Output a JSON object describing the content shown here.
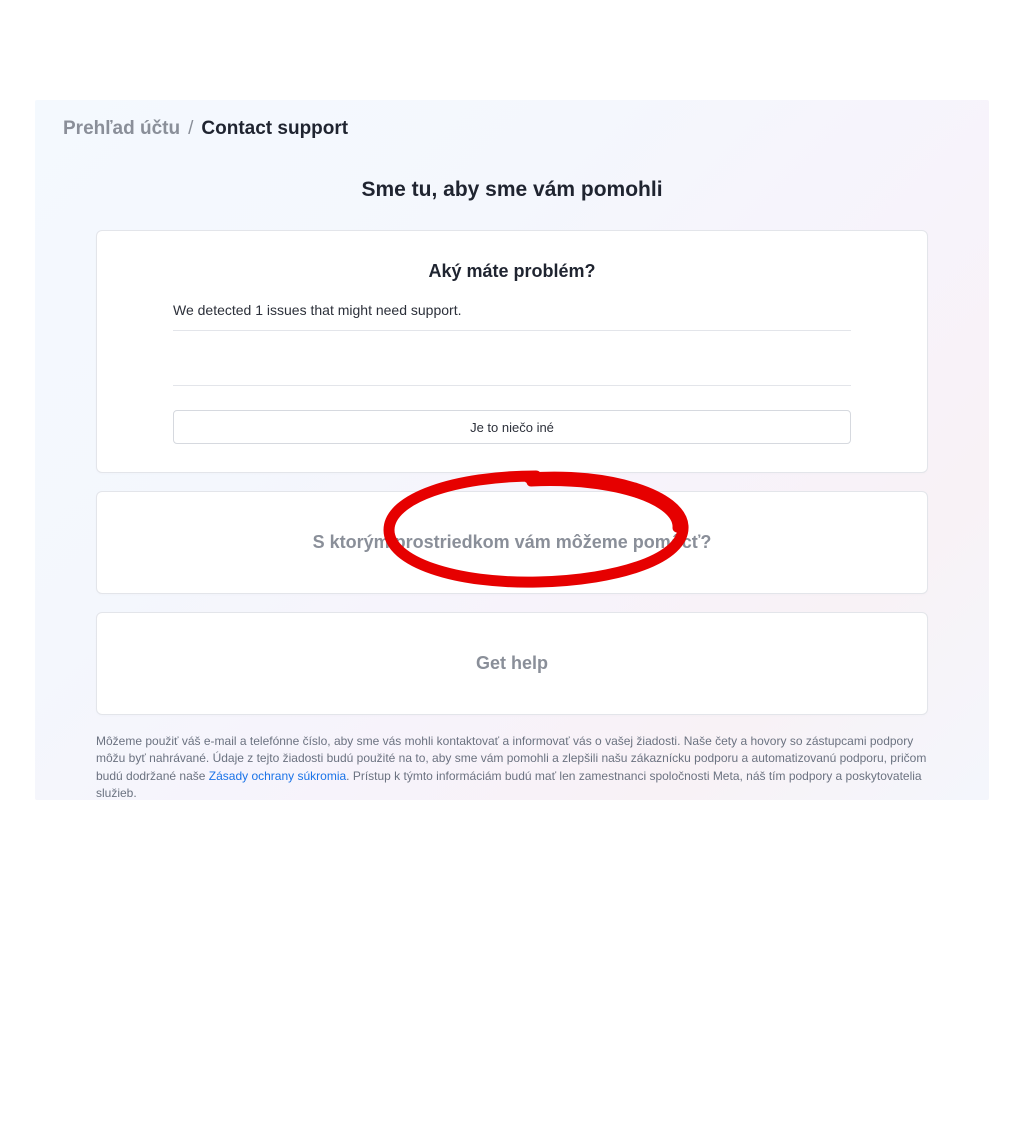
{
  "breadcrumb": {
    "parent": "Prehľad účtu",
    "separator": "/",
    "current": "Contact support"
  },
  "title": "Sme tu, aby sme vám pomohli",
  "main_card": {
    "heading": "Aký máte problém?",
    "issues_detected": "We detected 1 issues that might need support.",
    "other_button": "Je to niečo iné"
  },
  "asset_card": {
    "heading": "S ktorým prostriedkom vám môžeme pomôcť?"
  },
  "help_card": {
    "heading": "Get help"
  },
  "footer": {
    "part1": "Môžeme použiť váš e-mail a telefónne číslo, aby sme vás mohli kontaktovať a informovať vás o vašej žiadosti. Naše čety a hovory so zástupcami podpory môžu byť nahrávané. Údaje z tejto žiadosti budú použité na to, aby sme vám pomohli a zlepšili našu zákaznícku podporu a automatizovanú podporu, pričom budú dodržané naše ",
    "link": "Zásady ochrany súkromia",
    "part2": ". Prístup k týmto informáciám budú mať len zamestnanci spoločnosti Meta, náš tím podpory a poskytovatelia služieb."
  }
}
